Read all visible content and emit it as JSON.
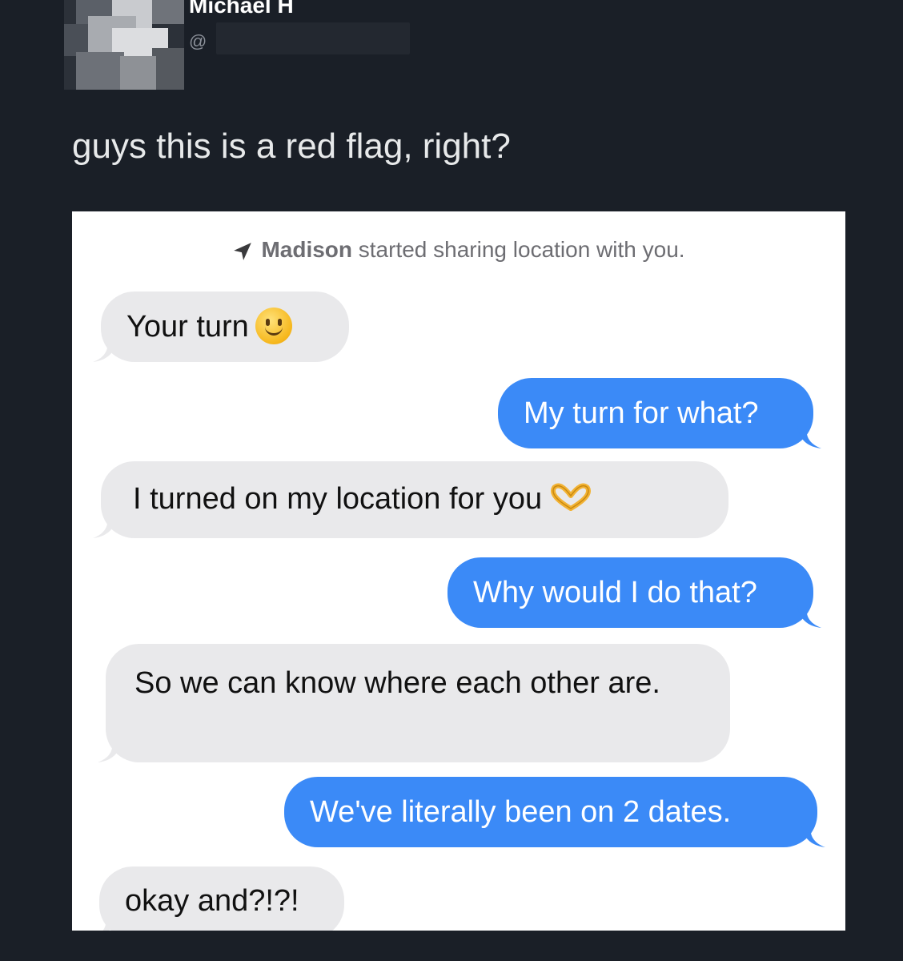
{
  "tweet": {
    "display_name": "Michael H",
    "handle_prefix": "@",
    "text": "guys this is a red flag, right?"
  },
  "conversation": {
    "system_note": {
      "contact_name": "Madison",
      "message": " started sharing location with you."
    },
    "messages": [
      {
        "direction": "received",
        "text": "Your turn",
        "emoji": "slightly-smiling-face"
      },
      {
        "direction": "sent",
        "text": "My turn for what?"
      },
      {
        "direction": "received",
        "text": "I turned on my location for you",
        "emoji": "heart-hands"
      },
      {
        "direction": "sent",
        "text": "Why would I do that?"
      },
      {
        "direction": "received",
        "text": "So we can know where each other are."
      },
      {
        "direction": "sent",
        "text": "We've literally been on 2 dates."
      },
      {
        "direction": "received",
        "text": "okay and?!?!"
      }
    ]
  },
  "colors": {
    "background": "#1a1f27",
    "sent_bubble": "#3b8af7",
    "received_bubble": "#e9e9eb"
  }
}
